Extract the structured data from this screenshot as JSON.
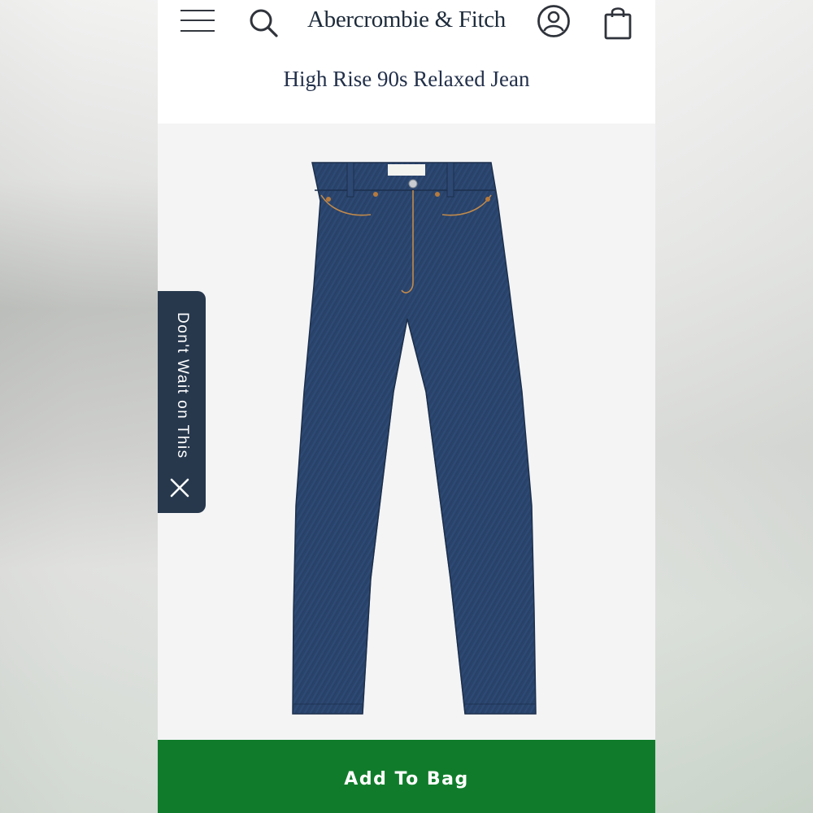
{
  "header": {
    "brand": "Abercrombie & Fitch",
    "icons": [
      "menu-icon",
      "search-icon",
      "account-icon",
      "shopping-bag-icon"
    ]
  },
  "product": {
    "title": "High Rise 90s Relaxed Jean",
    "image": "dark-wash-denim-jeans"
  },
  "side_tab": {
    "label": "Don't Wait on This",
    "close_icon": "close-icon"
  },
  "cta": {
    "label": "Add To Bag"
  },
  "colors": {
    "brand_text": "#1d2b3b",
    "side_tab_bg": "#27384d",
    "cta_bg": "#107c2b",
    "denim": "#2e4a73"
  }
}
